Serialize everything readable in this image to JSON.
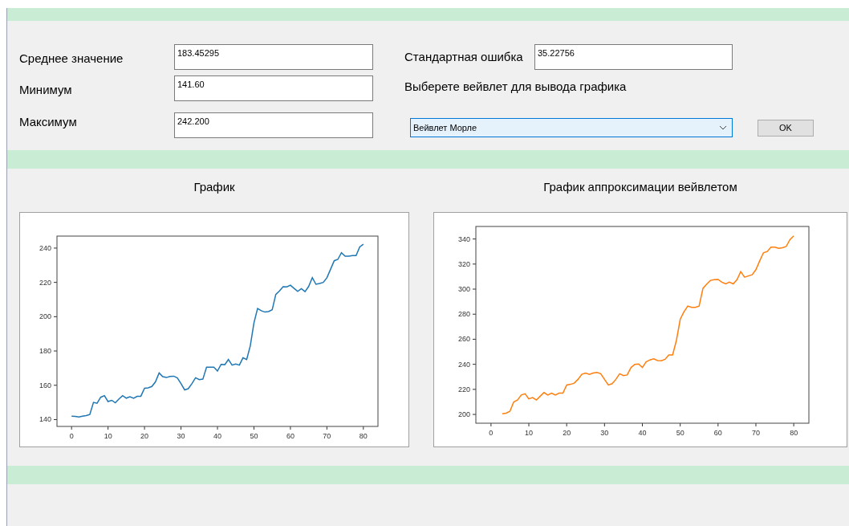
{
  "fields_left": [
    {
      "label": "Среднее значение",
      "value": "183.45295"
    },
    {
      "label": "Минимум",
      "value": "141.60"
    },
    {
      "label": "Максимум",
      "value": "242.200"
    }
  ],
  "standard_error": {
    "label": "Стандартная ошибка",
    "value": "35.22756"
  },
  "wavelet_prompt": "Выберете вейвлет для вывода графика",
  "wavelet_select": {
    "value": "Вейвлет Морле"
  },
  "ok_button": "OK",
  "charts": [
    {
      "title": "График",
      "chart_data": {
        "type": "line",
        "x": [
          0,
          1,
          2,
          3,
          4,
          5,
          6,
          7,
          8,
          9,
          10,
          11,
          12,
          13,
          14,
          15,
          16,
          17,
          18,
          19,
          20,
          21,
          22,
          23,
          24,
          25,
          26,
          27,
          28,
          29,
          30,
          31,
          32,
          33,
          34,
          35,
          36,
          37,
          38,
          39,
          40,
          41,
          42,
          43,
          44,
          45,
          46,
          47,
          48,
          49,
          50,
          51,
          52,
          53,
          54,
          55,
          56,
          57,
          58,
          59,
          60,
          61,
          62,
          63,
          64,
          65,
          66,
          67,
          68,
          69,
          70,
          71,
          72,
          73,
          74,
          75,
          76,
          77,
          78,
          79,
          80
        ],
        "series": [
          {
            "color": "#1f77b4",
            "values": [
              142,
              141.8,
              141.5,
              142,
              142.3,
              143,
              150,
              149.5,
              153,
              154,
              150.5,
              151.2,
              149.8,
              152,
              154,
              152.5,
              153.3,
              152.4,
              153.5,
              153.6,
              158.3,
              158.5,
              159.3,
              162,
              167.2,
              165,
              164.5,
              165.2,
              165.3,
              164.3,
              161,
              157.3,
              158,
              161,
              164.4,
              163.3,
              163.6,
              170.5,
              170.5,
              170.5,
              168.3,
              172.2,
              172,
              175,
              171.8,
              172.4,
              171.8,
              176,
              175,
              183,
              196.5,
              204.8,
              203.5,
              202.7,
              203,
              204,
              213,
              215,
              217.5,
              217.4,
              218.4,
              216.5,
              214.8,
              216.3,
              214.6,
              217.6,
              222.8,
              218.9,
              219.4,
              220,
              222.7,
              227.6,
              232.6,
              233.4,
              237.3,
              235.3,
              235.3,
              235.6,
              235.6,
              240.7,
              242.2
            ]
          }
        ],
        "xlim": [
          -4,
          84
        ],
        "ylim": [
          136,
          247
        ],
        "xticks": [
          0,
          10,
          20,
          30,
          40,
          50,
          60,
          70,
          80
        ],
        "yticks": [
          140,
          160,
          180,
          200,
          220,
          240
        ]
      }
    },
    {
      "title": "График аппроксимации вейвлетом",
      "chart_data": {
        "type": "line",
        "x": [
          3,
          4,
          5,
          6,
          7,
          8,
          9,
          10,
          11,
          12,
          13,
          14,
          15,
          16,
          17,
          18,
          19,
          20,
          21,
          22,
          23,
          24,
          25,
          26,
          27,
          28,
          29,
          30,
          31,
          32,
          33,
          34,
          35,
          36,
          37,
          38,
          39,
          40,
          41,
          42,
          43,
          44,
          45,
          46,
          47,
          48,
          49,
          50,
          51,
          52,
          53,
          54,
          55,
          56,
          57,
          58,
          59,
          60,
          61,
          62,
          63,
          64,
          65,
          66,
          67,
          68,
          69,
          70,
          71,
          72,
          73,
          74,
          75,
          76,
          77,
          78,
          79,
          80
        ],
        "series": [
          {
            "color": "#ff7f0e",
            "values": [
              200.5,
              201,
              202.5,
              210,
              211.5,
              215.5,
              216.5,
              212.5,
              213.5,
              211.5,
              214.5,
              217.5,
              215.5,
              217,
              215.5,
              217,
              217,
              223.5,
              224,
              225,
              228,
              232,
              233,
              232,
              233,
              233.5,
              232.5,
              228,
              223.5,
              224.5,
              228,
              232.5,
              231,
              231.5,
              237.5,
              240,
              240.2,
              237.5,
              242,
              243.5,
              244.3,
              243,
              242.8,
              244,
              247.5,
              247.5,
              259,
              276,
              282,
              286.5,
              285.5,
              285.5,
              286.5,
              300.5,
              304,
              307,
              307.5,
              307.7,
              305.5,
              304.2,
              305.5,
              304.2,
              307.5,
              314,
              309.5,
              310.5,
              311.5,
              315.5,
              322.5,
              329,
              330,
              333.5,
              333.5,
              332.5,
              333,
              334,
              339.5,
              342.5
            ]
          }
        ],
        "xlim": [
          -4,
          84
        ],
        "ylim": [
          193,
          350
        ],
        "xticks": [
          0,
          10,
          20,
          30,
          40,
          50,
          60,
          70,
          80
        ],
        "yticks": [
          200,
          220,
          240,
          260,
          280,
          300,
          320,
          340
        ]
      }
    }
  ]
}
